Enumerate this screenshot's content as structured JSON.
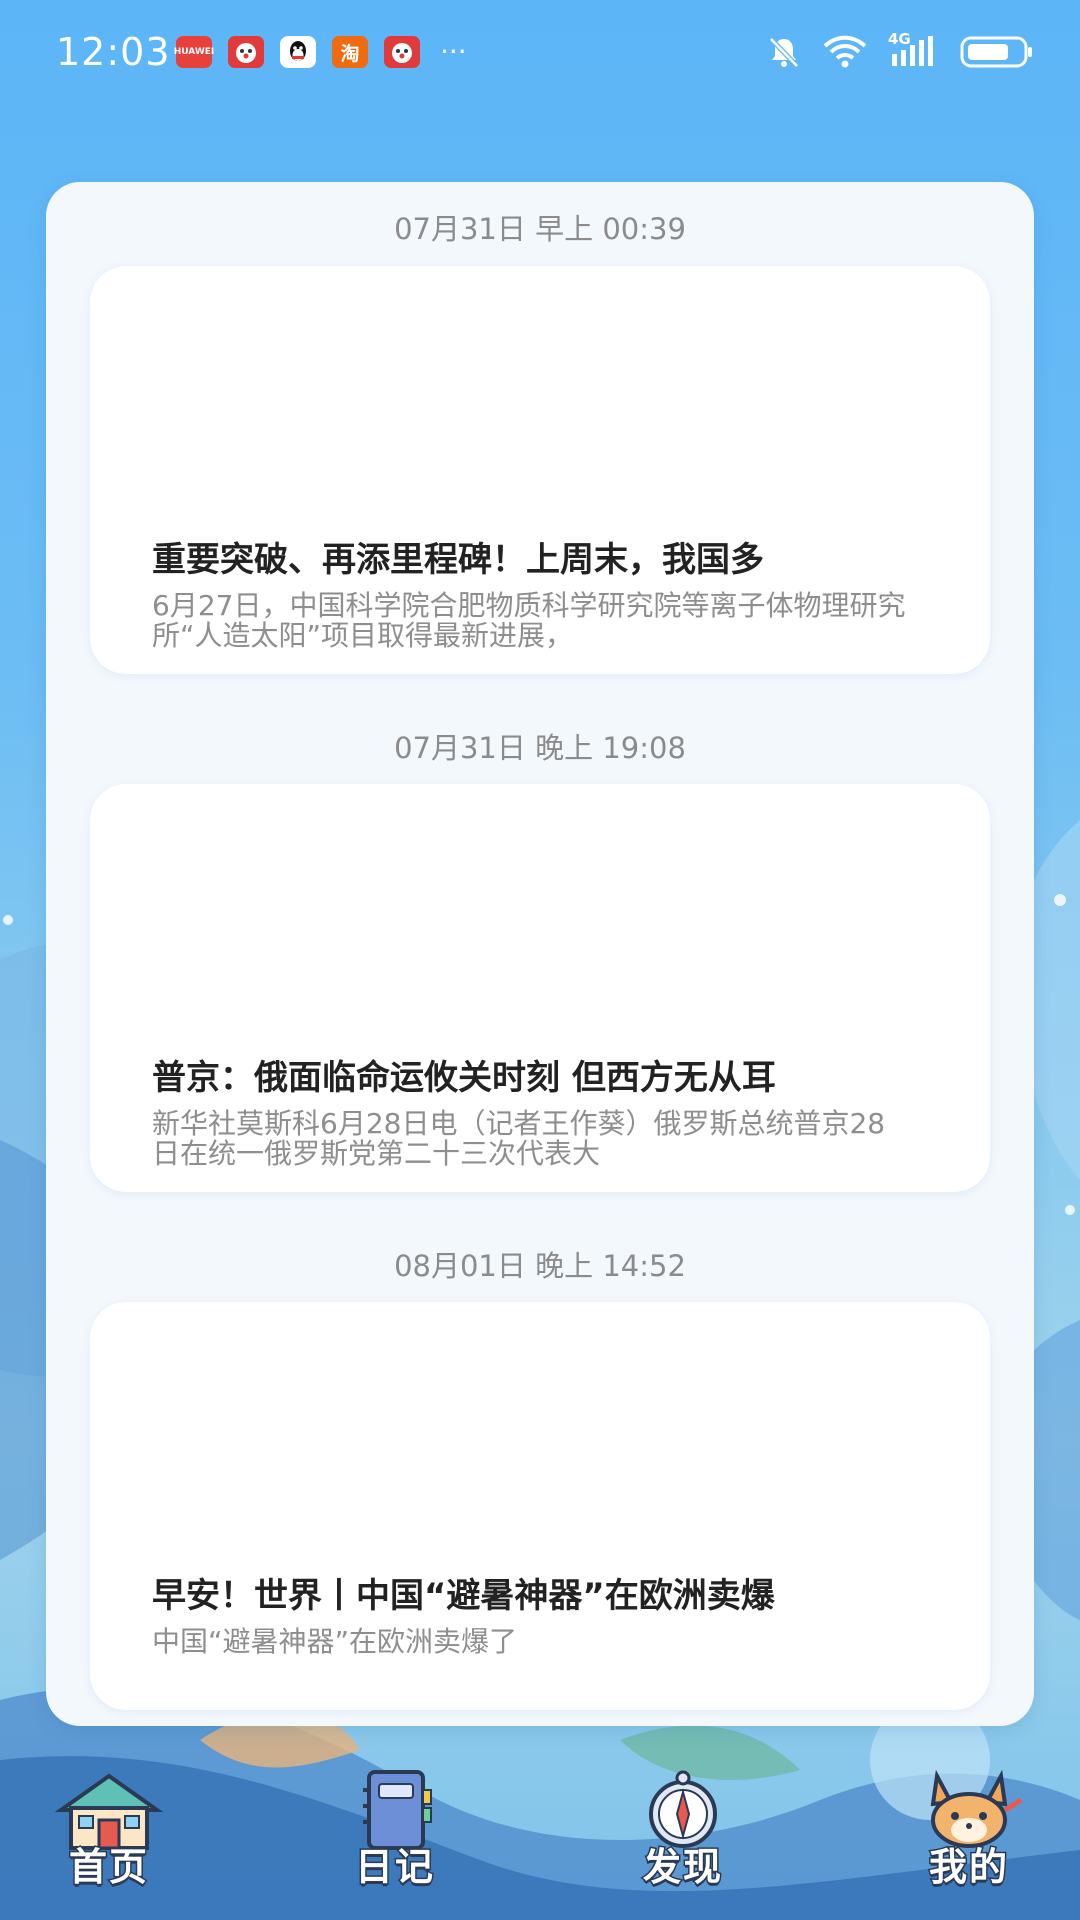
{
  "status_bar": {
    "time": "12:03",
    "notification_icons": [
      {
        "name": "huawei-store-icon",
        "glyph": "",
        "color": "#e8413c"
      },
      {
        "name": "cartoon-app-icon",
        "glyph": "",
        "color": "#e23a3a"
      },
      {
        "name": "qq-icon",
        "glyph": "🐧",
        "color": "#ffffff"
      },
      {
        "name": "taobao-icon",
        "glyph": "淘",
        "color": "#f06a10"
      },
      {
        "name": "cartoon-app-icon",
        "glyph": "",
        "color": "#e23a3a"
      }
    ],
    "more": "···",
    "network_label": "4G"
  },
  "feed": [
    {
      "date": "07月31日  早上 00:39",
      "title": "重要突破、再添里程碑！上周末，我国多",
      "summary": "6月27日，中国科学院合肥物质科学研究院等离子体物理研究所“人造太阳”项目取得最新进展，"
    },
    {
      "date": "07月31日  晚上 19:08",
      "title": "普京：俄面临命运攸关时刻 但西方无从耳",
      "summary": "新华社莫斯科6月28日电（记者王作葵）俄罗斯总统普京28日在统一俄罗斯党第二十三次代表大"
    },
    {
      "date": "08月01日  晚上 14:52",
      "title": "早安！世界丨中国“避暑神器”在欧洲卖爆",
      "summary": "中国“避暑神器”在欧洲卖爆了"
    }
  ],
  "nav": [
    {
      "label": "首页",
      "icon": "house-icon"
    },
    {
      "label": "日记",
      "icon": "diary-book-icon"
    },
    {
      "label": "发现",
      "icon": "compass-icon"
    },
    {
      "label": "我的",
      "icon": "fox-avatar-icon"
    }
  ]
}
